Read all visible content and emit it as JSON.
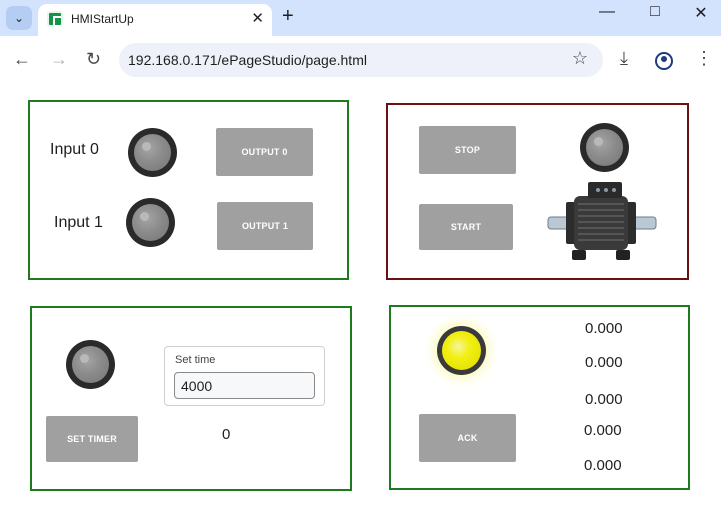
{
  "browser": {
    "tab_title": "HMIStartUp",
    "url": "192.168.0.171/ePageStudio/page.html",
    "icons": {
      "tab_menu": "chevron-down-icon",
      "tab_close": "close-icon",
      "new_tab": "plus-icon",
      "back": "arrow-left-icon",
      "forward": "arrow-right-icon",
      "reload": "reload-icon",
      "bookmark": "star-icon",
      "download": "download-icon",
      "profile": "profile-icon",
      "menu": "kebab-menu-icon"
    }
  },
  "io_panel": {
    "input0_label": "Input 0",
    "input1_label": "Input 1",
    "output0_label": "OUTPUT 0",
    "output1_label": "OUTPUT 1"
  },
  "motor_panel": {
    "stop_label": "STOP",
    "start_label": "START"
  },
  "timer_panel": {
    "set_time_caption": "Set time",
    "set_time_value": "4000",
    "set_timer_label": "SET TIMER",
    "timer_readout": "0"
  },
  "ack_panel": {
    "ack_label": "ACK",
    "values": [
      "0.000",
      "0.000",
      "0.000",
      "0.000",
      "0.000"
    ]
  },
  "colors": {
    "panel_green": "#1d7a1d",
    "panel_red": "#6b1111",
    "button_gray": "#a0a0a0",
    "lamp_yellow": "#f2ef12",
    "tab_strip": "#d3e3fd"
  }
}
